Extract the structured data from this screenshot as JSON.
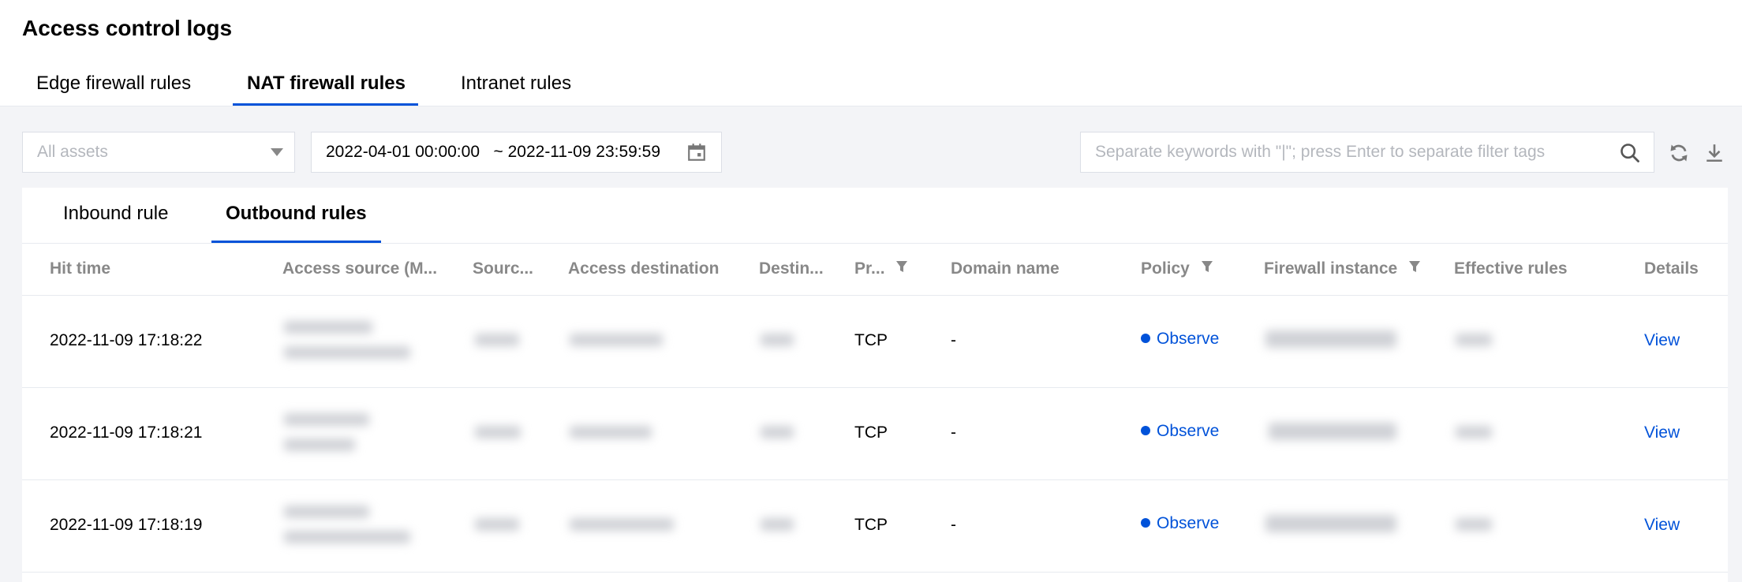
{
  "page": {
    "title": "Access control logs"
  },
  "main_tabs": [
    {
      "label": "Edge firewall rules",
      "active": false
    },
    {
      "label": "NAT firewall rules",
      "active": true
    },
    {
      "label": "Intranet rules",
      "active": false
    }
  ],
  "filters": {
    "assets_placeholder": "All assets",
    "date_range": "2022-04-01 00:00:00   ~ 2022-11-09 23:59:59",
    "search_placeholder": "Separate keywords with \"|\"; press Enter to separate filter tags"
  },
  "sub_tabs": [
    {
      "label": "Inbound rule",
      "active": false
    },
    {
      "label": "Outbound rules",
      "active": true
    }
  ],
  "table": {
    "columns": [
      {
        "label": "Hit time",
        "filter": false
      },
      {
        "label": "Access source (M...",
        "filter": false
      },
      {
        "label": "Sourc...",
        "filter": false
      },
      {
        "label": "Access destination",
        "filter": false
      },
      {
        "label": "Destin...",
        "filter": false
      },
      {
        "label": "Pr...",
        "filter": true
      },
      {
        "label": "Domain name",
        "filter": false
      },
      {
        "label": "Policy",
        "filter": true
      },
      {
        "label": "Firewall instance",
        "filter": true
      },
      {
        "label": "Effective rules",
        "filter": false
      },
      {
        "label": "Details",
        "filter": false
      }
    ],
    "rows": [
      {
        "hit_time": "2022-11-09 17:18:22",
        "protocol": "TCP",
        "domain": "-",
        "policy": "Observe",
        "details": "View"
      },
      {
        "hit_time": "2022-11-09 17:18:21",
        "protocol": "TCP",
        "domain": "-",
        "policy": "Observe",
        "details": "View"
      },
      {
        "hit_time": "2022-11-09 17:18:19",
        "protocol": "TCP",
        "domain": "-",
        "policy": "Observe",
        "details": "View"
      }
    ]
  },
  "colors": {
    "accent": "#0052d9",
    "header_text": "#888888",
    "page_bg": "#f3f4f7"
  }
}
